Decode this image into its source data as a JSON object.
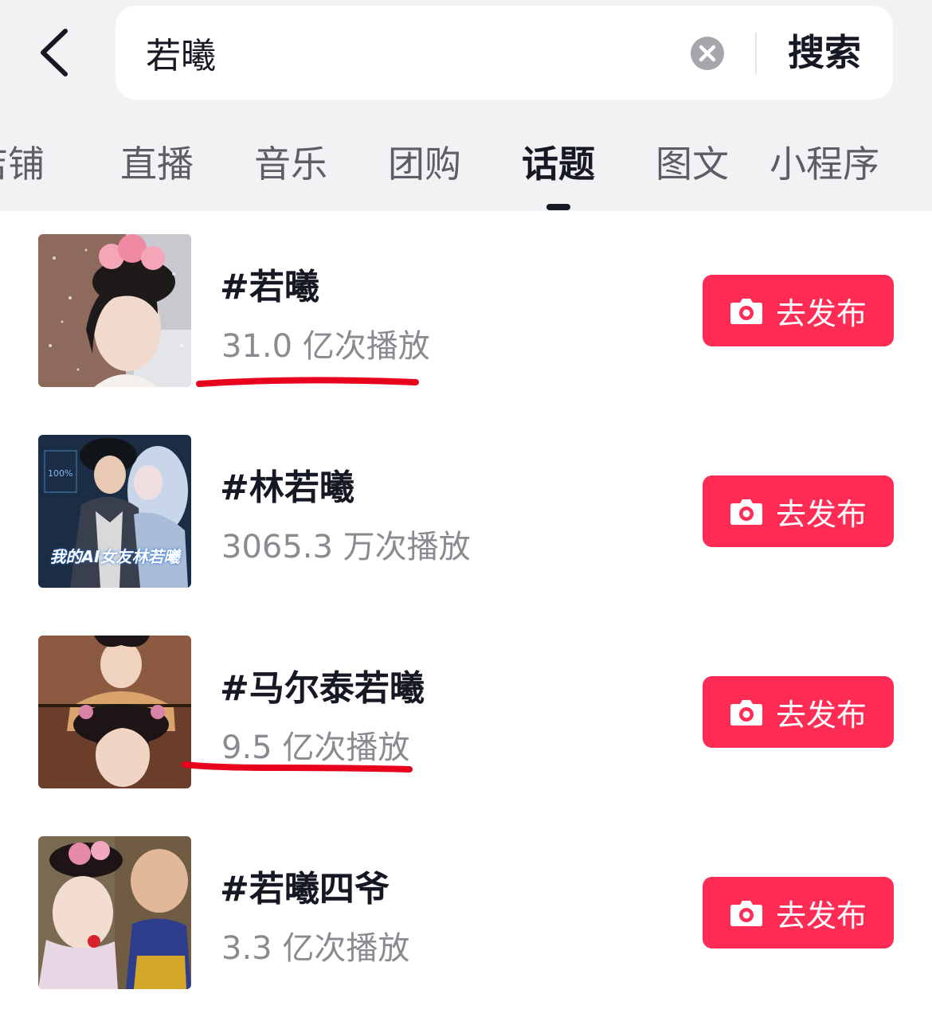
{
  "search": {
    "query": "若曦",
    "action_label": "搜索"
  },
  "tabs": [
    {
      "label": "店铺"
    },
    {
      "label": "直播"
    },
    {
      "label": "音乐"
    },
    {
      "label": "团购"
    },
    {
      "label": "话题",
      "active": true
    },
    {
      "label": "图文"
    },
    {
      "label": "小程序"
    }
  ],
  "topics": [
    {
      "title": "#若曦",
      "plays": "31.0 亿次播放",
      "button": "去发布",
      "highlighted": true
    },
    {
      "title": "#林若曦",
      "plays": "3065.3 万次播放",
      "button": "去发布",
      "thumb_text": "我的AI女友林若曦"
    },
    {
      "title": "#马尔泰若曦",
      "plays": "9.5 亿次播放",
      "button": "去发布",
      "highlighted": true
    },
    {
      "title": "#若曦四爷",
      "plays": "3.3 亿次播放",
      "button": "去发布"
    }
  ],
  "colors": {
    "accent": "#fe2c55",
    "annotation": "#e8001c",
    "header_bg": "#f2f2f4"
  },
  "icons": [
    "back-arrow-icon",
    "clear-icon",
    "camera-icon"
  ]
}
